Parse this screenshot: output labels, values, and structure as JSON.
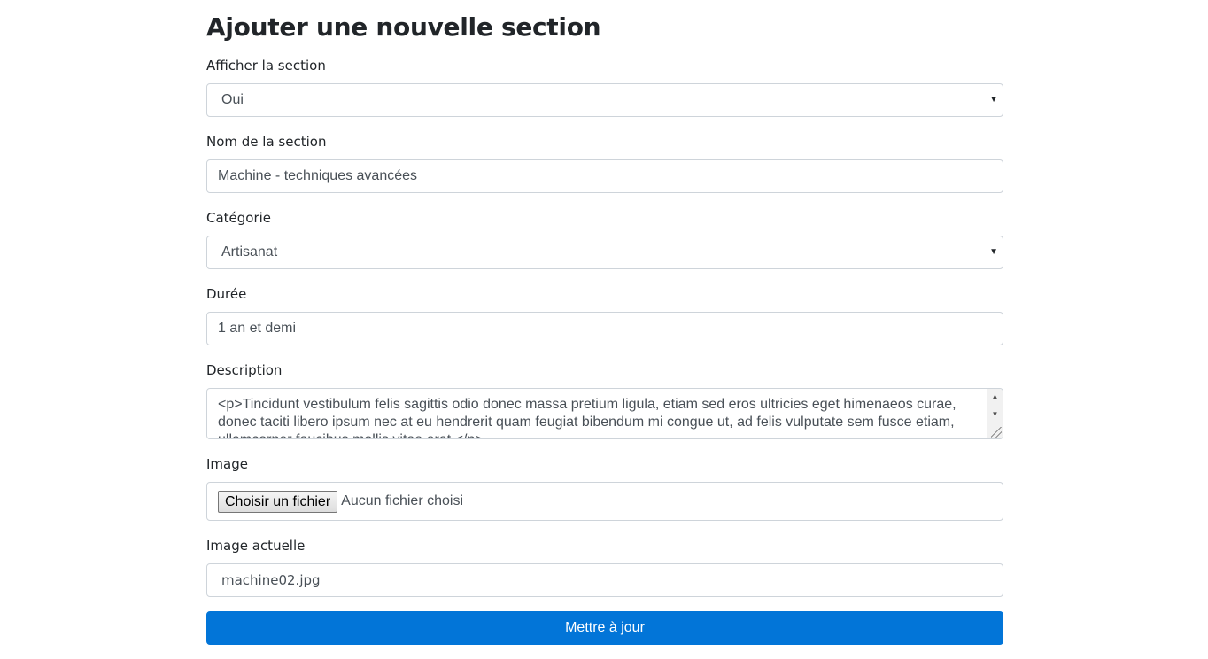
{
  "page": {
    "title": "Ajouter une nouvelle section"
  },
  "form": {
    "afficher": {
      "label": "Afficher la section",
      "value": "Oui"
    },
    "nom": {
      "label": "Nom de la section",
      "value": "Machine - techniques avancées"
    },
    "categorie": {
      "label": "Catégorie",
      "value": "Artisanat"
    },
    "duree": {
      "label": "Durée",
      "value": "1 an et demi"
    },
    "description": {
      "label": "Description",
      "value": "<p>Tincidunt vestibulum felis sagittis odio donec massa pretium ligula, etiam sed eros ultricies eget himenaeos curae, donec taciti libero ipsum nec at eu hendrerit quam feugiat bibendum mi congue ut, ad felis vulputate sem fusce etiam, ullamcorper faucibus mollis vitae erat.</p>"
    },
    "image": {
      "label": "Image",
      "button_label": "Choisir un fichier",
      "status": "Aucun fichier choisi"
    },
    "image_actuelle": {
      "label": "Image actuelle",
      "value": "machine02.jpg"
    },
    "submit_label": "Mettre à jour"
  },
  "icons": {
    "select_caret": "caret-down-icon",
    "scroll_up": "scroll-up-arrow-icon",
    "scroll_down": "scroll-down-arrow-icon"
  }
}
